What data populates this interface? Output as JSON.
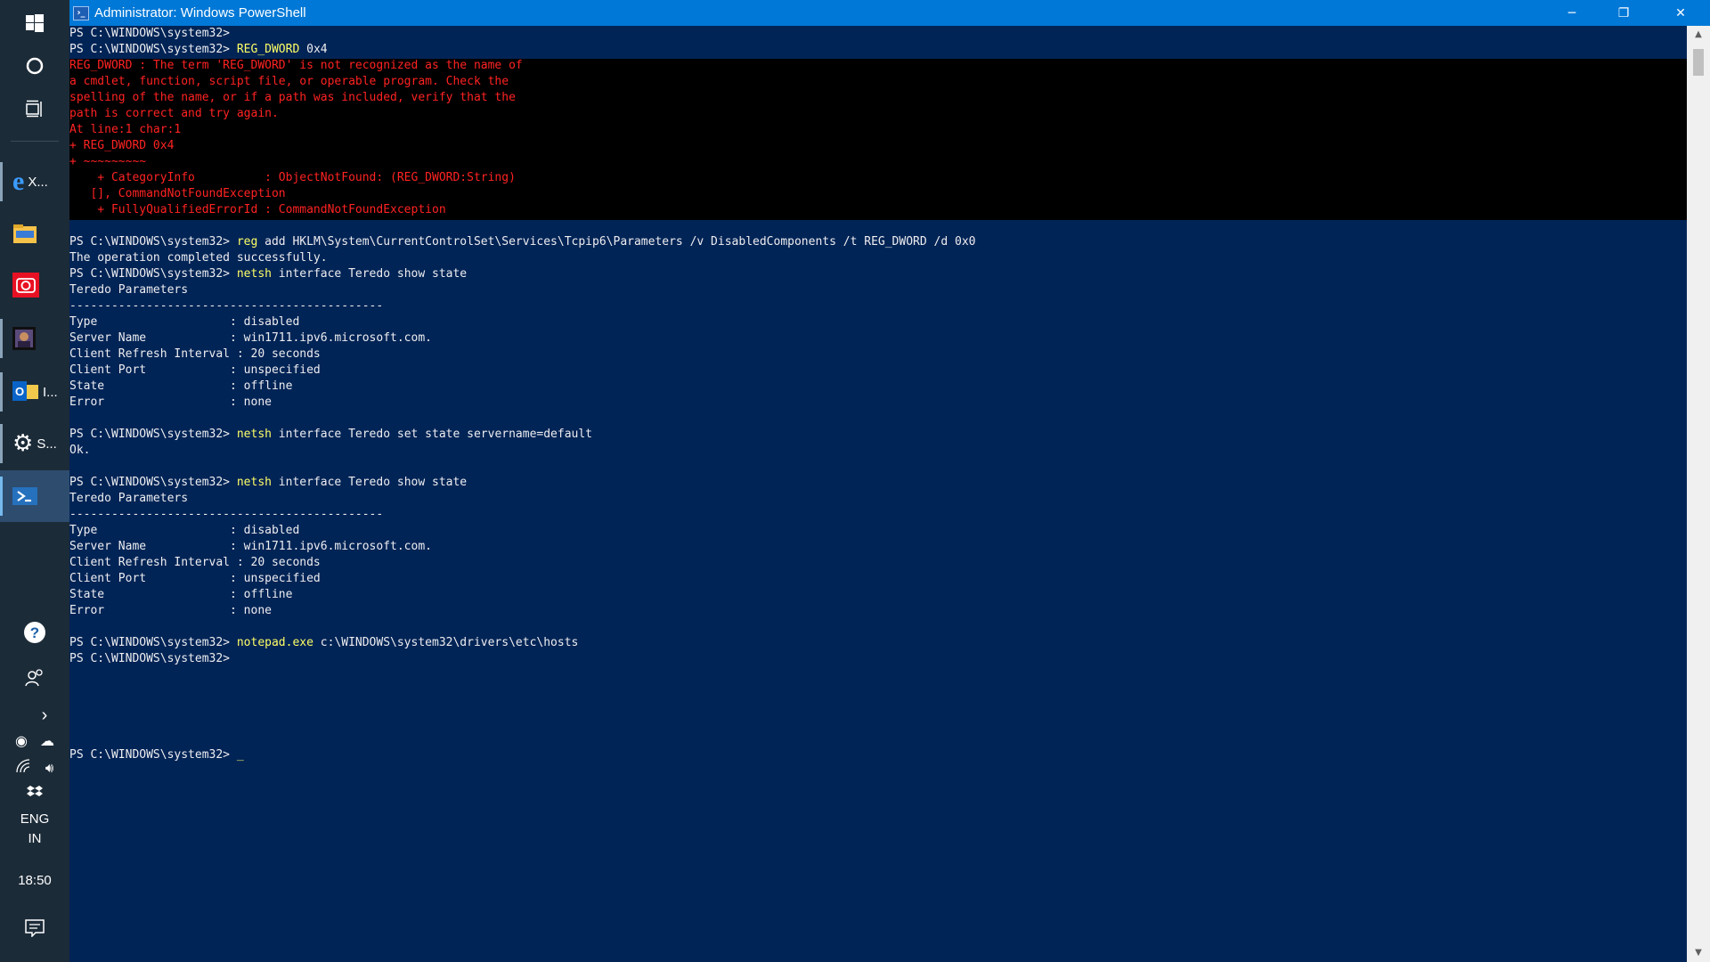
{
  "window": {
    "title": "Administrator: Windows PowerShell",
    "controls": {
      "minimize": "─",
      "restore": "❐",
      "close": "✕"
    }
  },
  "taskbar": {
    "apps": [
      {
        "id": "edge",
        "label": "X...",
        "icon": "edge-icon"
      },
      {
        "id": "explorer",
        "label": "",
        "icon": "file-explorer-icon"
      },
      {
        "id": "camera",
        "label": "",
        "icon": "camera-icon"
      },
      {
        "id": "photo",
        "label": "",
        "icon": "photo-app-icon"
      },
      {
        "id": "outlook",
        "label": "I...",
        "icon": "outlook-icon"
      },
      {
        "id": "settings",
        "label": "S...",
        "icon": "gear-icon"
      },
      {
        "id": "powershell",
        "label": "",
        "icon": "powershell-icon"
      }
    ],
    "tray": {
      "language_line1": "ENG",
      "language_line2": "IN",
      "time": "18:50"
    }
  },
  "console": {
    "lines_top": [
      {
        "prompt": "PS C:\\WINDOWS\\system32> ",
        "cmd": "",
        "rest": ""
      },
      {
        "prompt": "PS C:\\WINDOWS\\system32> ",
        "cmd": "REG_DWORD",
        "rest": " 0x4"
      }
    ],
    "error_lines": [
      "REG_DWORD : The term 'REG_DWORD' is not recognized as the name of",
      "a cmdlet, function, script file, or operable program. Check the",
      "spelling of the name, or if a path was included, verify that the",
      "path is correct and try again.",
      "At line:1 char:1",
      "+ REG_DWORD 0x4",
      "+ ~~~~~~~~~",
      "    + CategoryInfo          : ObjectNotFound: (REG_DWORD:String)",
      "   [], CommandNotFoundException",
      "    + FullyQualifiedErrorId : CommandNotFoundException"
    ],
    "lines_after_error": [
      {
        "type": "blank"
      },
      {
        "type": "cmd",
        "prompt": "PS C:\\WINDOWS\\system32> ",
        "cmd": "reg",
        "rest": " add HKLM\\System\\CurrentControlSet\\Services\\Tcpip6\\Parameters /v DisabledComponents /t REG_DWORD /d 0x0"
      },
      {
        "type": "out",
        "text": "The operation completed successfully."
      },
      {
        "type": "cmd",
        "prompt": "PS C:\\WINDOWS\\system32> ",
        "cmd": "netsh",
        "rest": " interface Teredo show state"
      },
      {
        "type": "out",
        "text": "Teredo Parameters"
      },
      {
        "type": "out",
        "text": "---------------------------------------------"
      },
      {
        "type": "out",
        "text": "Type                   : disabled"
      },
      {
        "type": "out",
        "text": "Server Name            : win1711.ipv6.microsoft.com."
      },
      {
        "type": "out",
        "text": "Client Refresh Interval : 20 seconds"
      },
      {
        "type": "out",
        "text": "Client Port            : unspecified"
      },
      {
        "type": "out",
        "text": "State                  : offline"
      },
      {
        "type": "out",
        "text": "Error                  : none"
      },
      {
        "type": "blank"
      },
      {
        "type": "cmd",
        "prompt": "PS C:\\WINDOWS\\system32> ",
        "cmd": "netsh",
        "rest": " interface Teredo set state servername=default"
      },
      {
        "type": "out",
        "text": "Ok."
      },
      {
        "type": "blank"
      },
      {
        "type": "cmd",
        "prompt": "PS C:\\WINDOWS\\system32> ",
        "cmd": "netsh",
        "rest": " interface Teredo show state"
      },
      {
        "type": "out",
        "text": "Teredo Parameters"
      },
      {
        "type": "out",
        "text": "---------------------------------------------"
      },
      {
        "type": "out",
        "text": "Type                   : disabled"
      },
      {
        "type": "out",
        "text": "Server Name            : win1711.ipv6.microsoft.com."
      },
      {
        "type": "out",
        "text": "Client Refresh Interval : 20 seconds"
      },
      {
        "type": "out",
        "text": "Client Port            : unspecified"
      },
      {
        "type": "out",
        "text": "State                  : offline"
      },
      {
        "type": "out",
        "text": "Error                  : none"
      },
      {
        "type": "blank"
      },
      {
        "type": "cmd",
        "prompt": "PS C:\\WINDOWS\\system32> ",
        "cmd": "notepad.exe",
        "rest": " c:\\WINDOWS\\system32\\drivers\\etc\\hosts"
      },
      {
        "type": "out",
        "text": "PS C:\\WINDOWS\\system32>"
      }
    ],
    "final_prompt": "PS C:\\WINDOWS\\system32> ",
    "cursor": "_"
  },
  "colors": {
    "console_bg": "#012456",
    "titlebar_bg": "#0078d7",
    "error_fg": "#ff2222",
    "command_fg": "#ffff66"
  }
}
